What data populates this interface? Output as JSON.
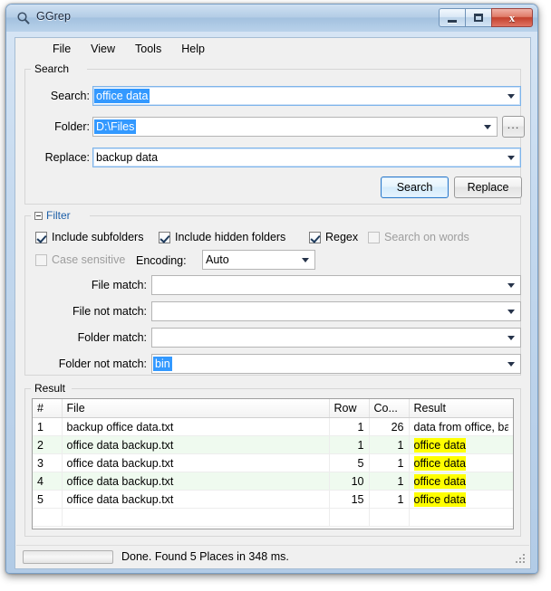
{
  "window": {
    "title": "GGrep",
    "icon": "magnifier-icon",
    "buttons": {
      "minimize": "minimize-icon",
      "maximize": "maximize-icon",
      "close": "close-icon"
    }
  },
  "menu": {
    "items": [
      "File",
      "View",
      "Tools",
      "Help"
    ]
  },
  "search_group": {
    "label": "Search",
    "fields": [
      {
        "label": "Search:",
        "value": "office data",
        "selected": true
      },
      {
        "label": "Folder:",
        "value": "D:\\Files",
        "selected": true
      },
      {
        "label": "Replace:",
        "value": "backup data",
        "selected": false
      }
    ],
    "browse_label": "...",
    "search_button": "Search",
    "replace_button": "Replace"
  },
  "filter_group": {
    "label": "Filter",
    "expander": "collapse-icon",
    "checkboxes": [
      {
        "label": "Include subfolders",
        "checked": true,
        "disabled": false
      },
      {
        "label": "Include hidden folders",
        "checked": true,
        "disabled": false
      },
      {
        "label": "Regex",
        "checked": true,
        "disabled": false
      },
      {
        "label": "Search on words",
        "checked": false,
        "disabled": true
      },
      {
        "label": "Case sensitive",
        "checked": false,
        "disabled": true
      }
    ],
    "encoding_label": "Encoding:",
    "encoding_value": "Auto",
    "match_fields": [
      {
        "label": "File match:",
        "value": "",
        "selected": false
      },
      {
        "label": "File not match:",
        "value": "",
        "selected": false
      },
      {
        "label": "Folder match:",
        "value": "",
        "selected": false
      },
      {
        "label": "Folder not match:",
        "value": "bin",
        "selected": true
      }
    ]
  },
  "result_group": {
    "label": "Result",
    "columns": [
      "#",
      "File",
      "Row",
      "Co...",
      "Result"
    ],
    "rows": [
      {
        "n": "1",
        "file": "backup office data.txt",
        "row": "1",
        "col": "26",
        "result": "data from office, back",
        "highlight": false
      },
      {
        "n": "2",
        "file": "office data backup.txt",
        "row": "1",
        "col": "1",
        "result": "office data",
        "highlight": true
      },
      {
        "n": "3",
        "file": "office data backup.txt",
        "row": "5",
        "col": "1",
        "result": "office data",
        "highlight": true
      },
      {
        "n": "4",
        "file": "office data backup.txt",
        "row": "10",
        "col": "1",
        "result": "office data",
        "highlight": true
      },
      {
        "n": "5",
        "file": "office data backup.txt",
        "row": "15",
        "col": "1",
        "result": "office data",
        "highlight": true
      }
    ]
  },
  "status": {
    "text": "Done. Found 5 Places in 348 ms.",
    "progress_percent": 0
  },
  "colors": {
    "selection": "#3399ff",
    "highlight": "#ffff00",
    "alt_row": "#effaef",
    "accent": "#1d5fa8"
  }
}
